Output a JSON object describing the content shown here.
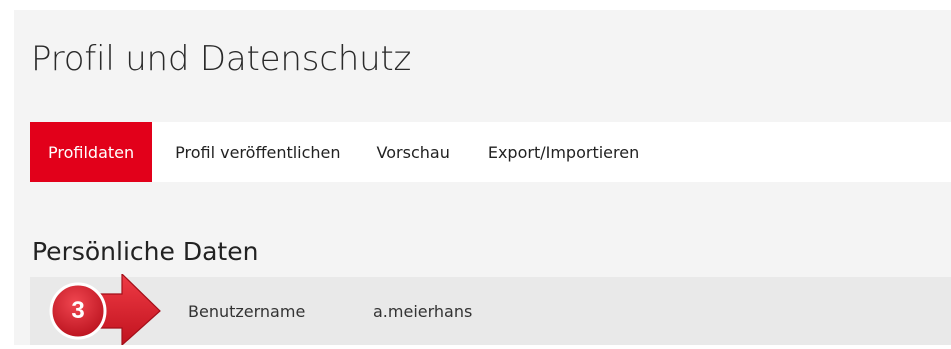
{
  "page": {
    "title": "Profil und Datenschutz"
  },
  "tabs": [
    {
      "label": "Profildaten",
      "active": true
    },
    {
      "label": "Profil veröffentlichen",
      "active": false
    },
    {
      "label": "Vorschau",
      "active": false
    },
    {
      "label": "Export/Importieren",
      "active": false
    }
  ],
  "section": {
    "title": "Persönliche Daten"
  },
  "fields": [
    {
      "label": "Benutzername",
      "value": "a.meierhans"
    }
  ],
  "callout": {
    "number": "3",
    "icon": "arrow-right-icon"
  },
  "colors": {
    "accent": "#e2001a",
    "callout_red": "#d9202e",
    "page_background": "#f4f4f4",
    "row_background": "#e9e9e9"
  }
}
